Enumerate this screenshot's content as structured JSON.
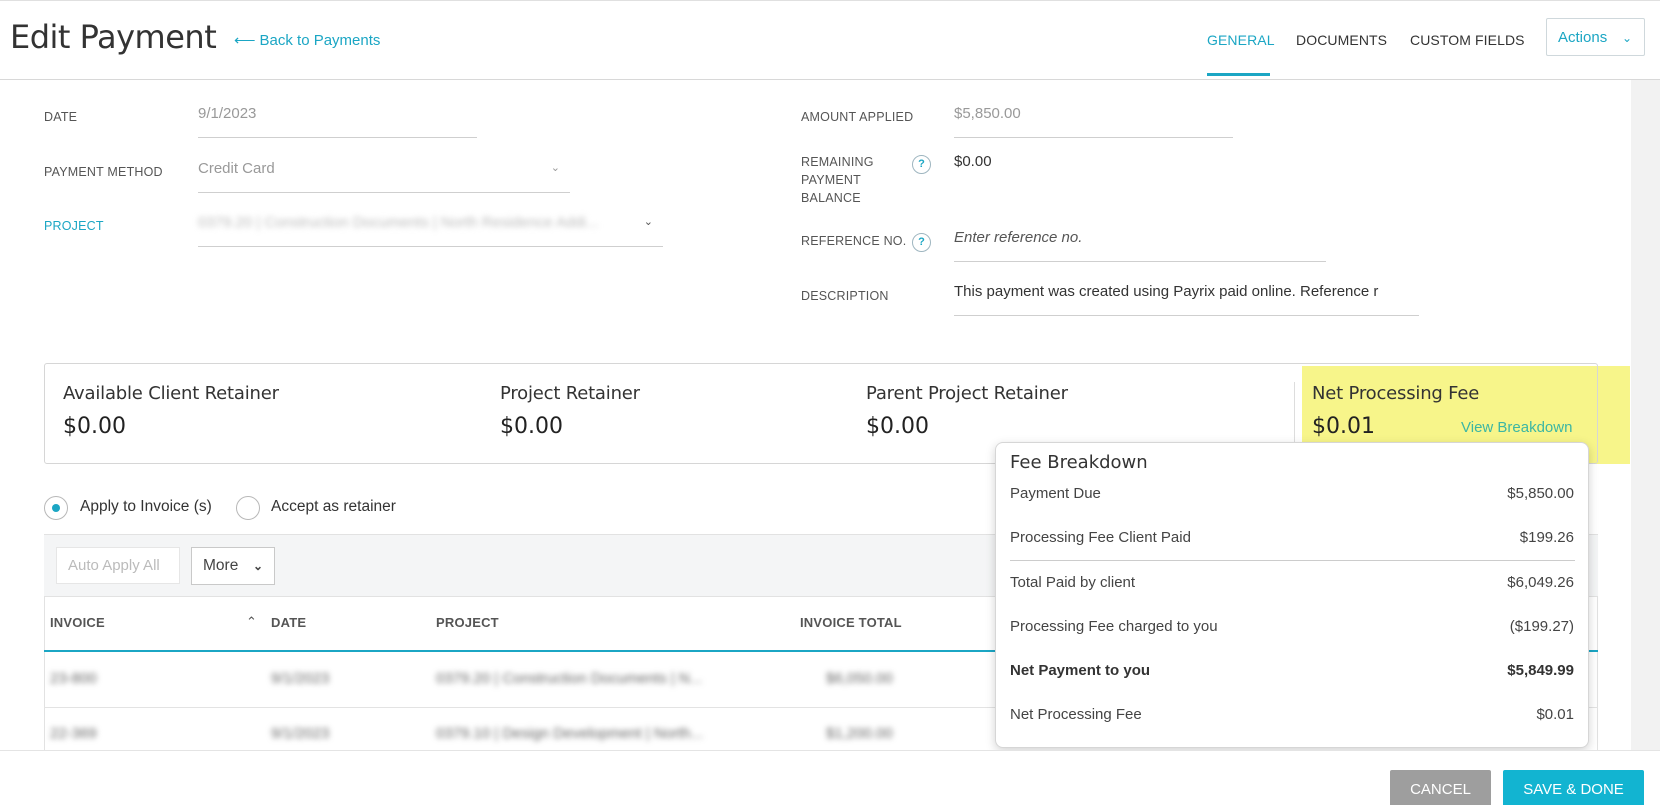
{
  "header": {
    "title": "Edit Payment",
    "back_link": "Back to Payments",
    "tabs": [
      "GENERAL",
      "DOCUMENTS",
      "CUSTOM FIELDS"
    ],
    "active_tab": "GENERAL",
    "actions_label": "Actions"
  },
  "form": {
    "date_label": "DATE",
    "date_value": "9/1/2023",
    "payment_method_label": "PAYMENT METHOD",
    "payment_method_value": "Credit Card",
    "project_label": "PROJECT",
    "project_value": "0379.20 | Construction Documents | North Residence Addi...",
    "amount_applied_label": "AMOUNT APPLIED",
    "amount_applied_value": "$5,850.00",
    "remaining_label_1": "REMAINING",
    "remaining_label_2": "PAYMENT",
    "remaining_label_3": "BALANCE",
    "remaining_value": "$0.00",
    "reference_label": "REFERENCE NO.",
    "reference_placeholder": "Enter reference no.",
    "description_label": "DESCRIPTION",
    "description_value": "This payment was created using Payrix paid online. Reference r"
  },
  "retainers": {
    "available_client_title": "Available Client Retainer",
    "available_client_value": "$0.00",
    "project_title": "Project Retainer",
    "project_value": "$0.00",
    "parent_title": "Parent Project Retainer",
    "parent_value": "$0.00",
    "net_fee_title": "Net Processing Fee",
    "net_fee_value": "$0.01",
    "view_breakdown": "View Breakdown"
  },
  "apply_options": {
    "apply_invoice": "Apply to Invoice (s)",
    "accept_retainer": "Accept as retainer",
    "selected": "apply_invoice"
  },
  "table": {
    "auto_apply": "Auto Apply All",
    "more": "More",
    "columns": [
      "INVOICE",
      "DATE",
      "PROJECT",
      "INVOICE TOTAL"
    ],
    "rows": [
      [
        "23-800",
        "9/1/2023",
        "0379.20 | Construction Documents | N...",
        "$6,050.00"
      ],
      [
        "22-369",
        "9/1/2023",
        "0379.10 | Design Development | North...",
        "$1,200.00"
      ]
    ]
  },
  "fee_breakdown": {
    "title": "Fee Breakdown",
    "items": [
      {
        "label": "Payment Due",
        "value": "$5,850.00"
      },
      {
        "label": "Processing Fee Client Paid",
        "value": "$199.26"
      },
      {
        "label": "Total Paid by client",
        "value": "$6,049.26"
      },
      {
        "label": "Processing Fee charged to you",
        "value": "($199.27)"
      },
      {
        "label": "Net Payment to you",
        "value": "$5,849.99"
      },
      {
        "label": "Net Processing Fee",
        "value": "$0.01"
      }
    ]
  },
  "footer": {
    "cancel": "CANCEL",
    "save": "SAVE & DONE"
  },
  "colors": {
    "accent": "#1ba6c4",
    "highlight": "#f7f58a",
    "save_button": "#12b4d1",
    "cancel_button": "#9e9e9e"
  }
}
